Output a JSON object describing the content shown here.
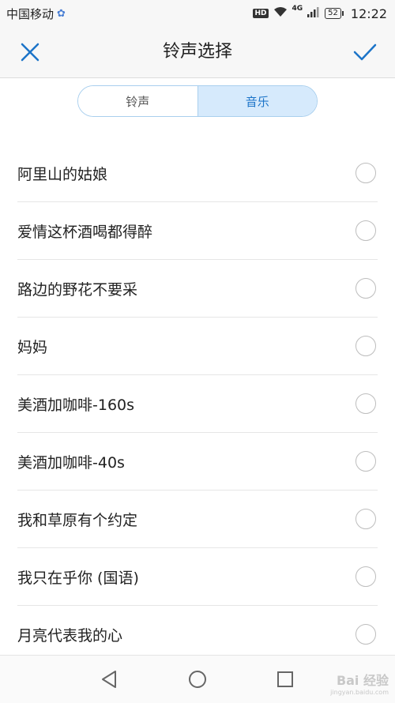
{
  "status_bar": {
    "carrier": "中国移动",
    "hd": "HD",
    "network": "4G",
    "battery": "52",
    "time": "12:22"
  },
  "header": {
    "title": "铃声选择",
    "close_icon": "close-icon",
    "confirm_icon": "check-icon"
  },
  "tabs": [
    {
      "label": "铃声",
      "active": false
    },
    {
      "label": "音乐",
      "active": true
    }
  ],
  "songs": [
    {
      "label": "阿里山的姑娘",
      "selected": false
    },
    {
      "label": "爱情这杯酒喝都得醉",
      "selected": false
    },
    {
      "label": "路边的野花不要采",
      "selected": false
    },
    {
      "label": "妈妈",
      "selected": false
    },
    {
      "label": "美酒加咖啡-160s",
      "selected": false
    },
    {
      "label": "美酒加咖啡-40s",
      "selected": false
    },
    {
      "label": "我和草原有个约定",
      "selected": false
    },
    {
      "label": "我只在乎你 (国语)",
      "selected": false
    },
    {
      "label": "月亮代表我的心",
      "selected": false
    }
  ],
  "nav": {
    "back_icon": "back-triangle-icon",
    "home_icon": "home-circle-icon",
    "recents_icon": "recents-square-icon"
  },
  "watermark": {
    "text": "Bai 经验",
    "sub": "jingyan.baidu.com"
  },
  "colors": {
    "accent": "#1c74c8",
    "tab_active_bg": "#d6eafc",
    "bar_bg": "#f7f7f7"
  }
}
